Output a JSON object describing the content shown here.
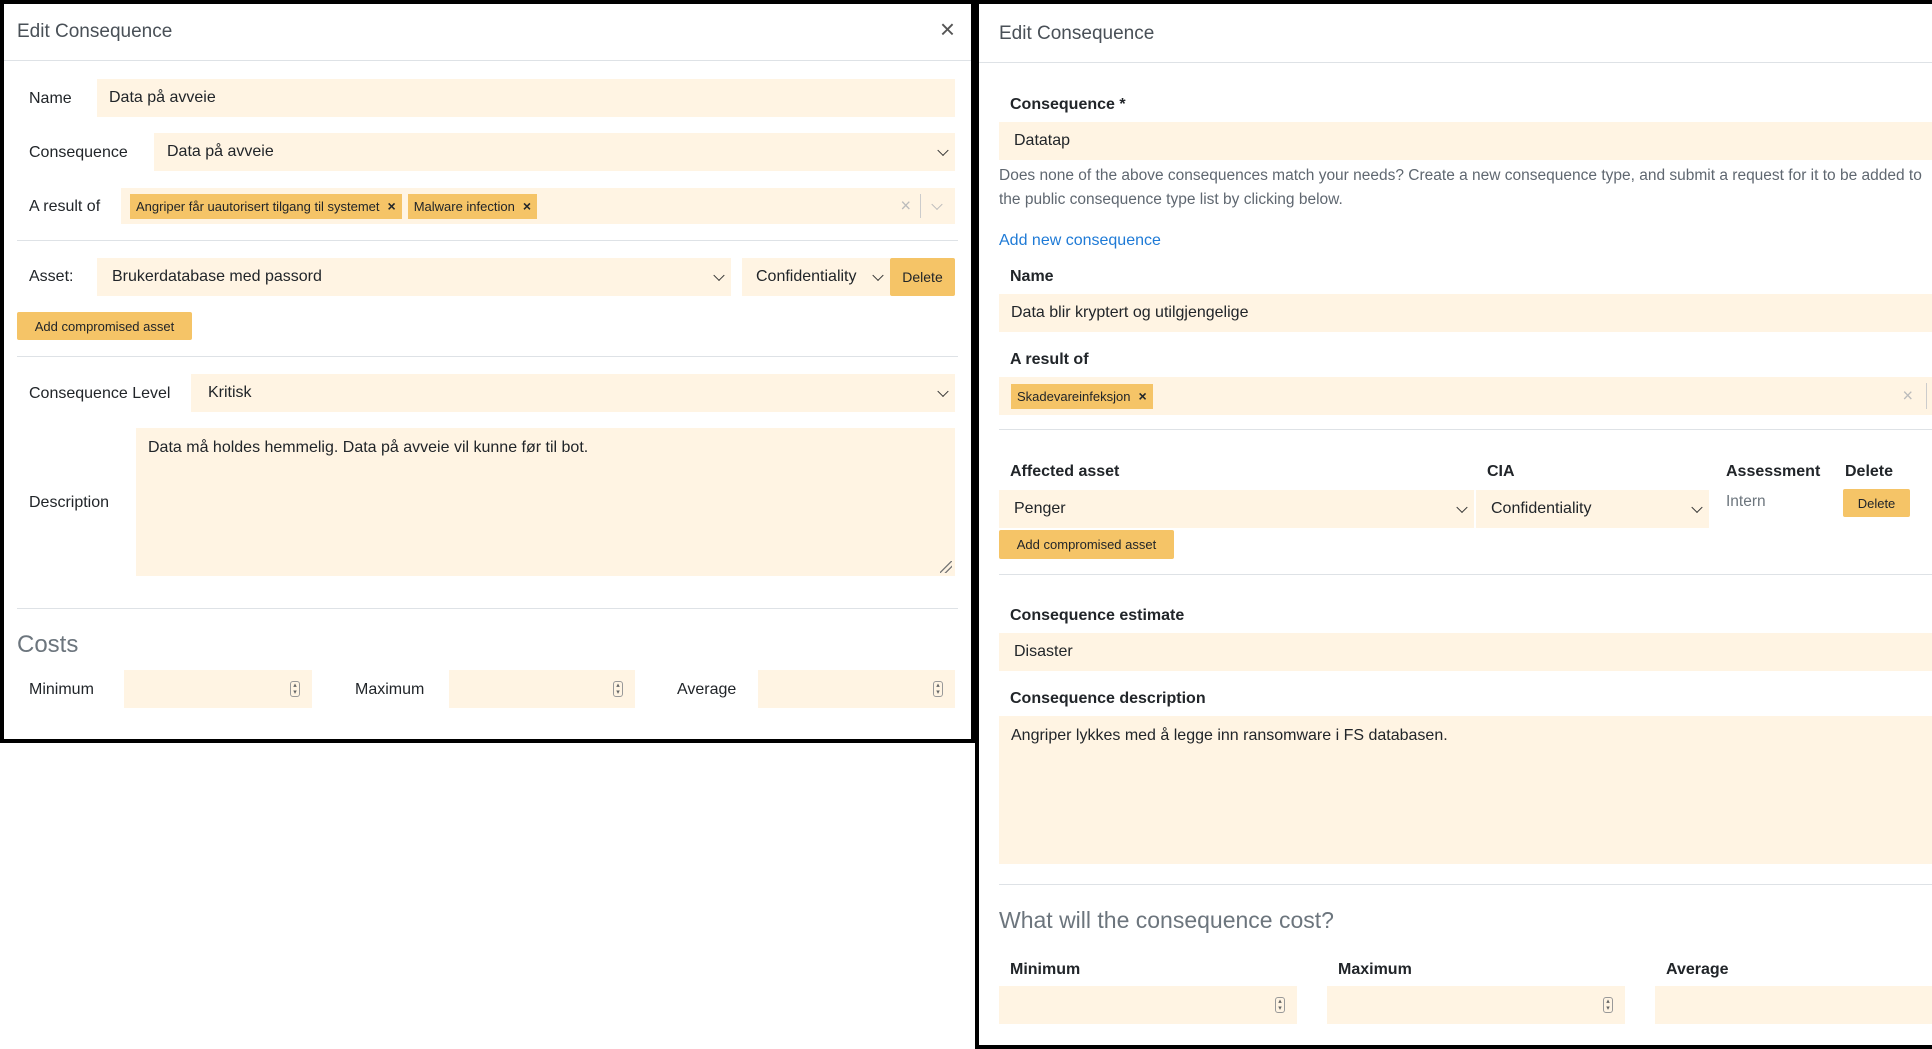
{
  "left": {
    "title": "Edit Consequence",
    "close_label": "×",
    "name_label": "Name",
    "name_value": "Data på avveie",
    "consequence_label": "Consequence",
    "consequence_value": "Data på avveie",
    "result_label": "A result of",
    "result_tags": [
      "Angriper får uautorisert tilgang til systemet",
      "Malware infection"
    ],
    "asset_label": "Asset:",
    "asset_value": "Brukerdatabase med passord",
    "cia_value": "Confidentiality",
    "delete_label": "Delete",
    "add_asset_label": "Add compromised asset",
    "level_label": "Consequence Level",
    "level_value": "Kritisk",
    "description_label": "Description",
    "description_value": "Data må holdes hemmelig. Data på avveie vil kunne før til bot.",
    "costs_heading": "Costs",
    "min_label": "Minimum",
    "max_label": "Maximum",
    "avg_label": "Average"
  },
  "right": {
    "title": "Edit Consequence",
    "consequence_label": "Consequence *",
    "consequence_value": "Datatap",
    "help_line1": "Does none of the above consequences match your needs? Create a new consequence type, and submit a request for it to be added to",
    "help_line2": "the public consequence type list by clicking below.",
    "add_consequence_link": "Add new consequence",
    "name_label": "Name",
    "name_value": "Data blir kryptert og utilgjengelige",
    "result_label": "A result of",
    "result_tags": [
      "Skadevareinfeksjon"
    ],
    "affected_asset_label": "Affected asset",
    "cia_label": "CIA",
    "assessment_label": "Assessment",
    "delete_col_label": "Delete",
    "asset_value": "Penger",
    "cia_value": "Confidentiality",
    "assessment_value": "Intern",
    "delete_label": "Delete",
    "add_asset_label": "Add compromised asset",
    "estimate_label": "Consequence estimate",
    "estimate_value": "Disaster",
    "description_label": "Consequence description",
    "description_value": "Angriper lykkes med å legge inn ransomware i FS databasen.",
    "cost_heading": "What will the consequence cost?",
    "min_label": "Minimum",
    "max_label": "Maximum",
    "avg_label": "Average"
  },
  "colors": {
    "field_bg": "#fff4e3",
    "button_bg": "#f5c467",
    "link": "#1e7ad6"
  }
}
